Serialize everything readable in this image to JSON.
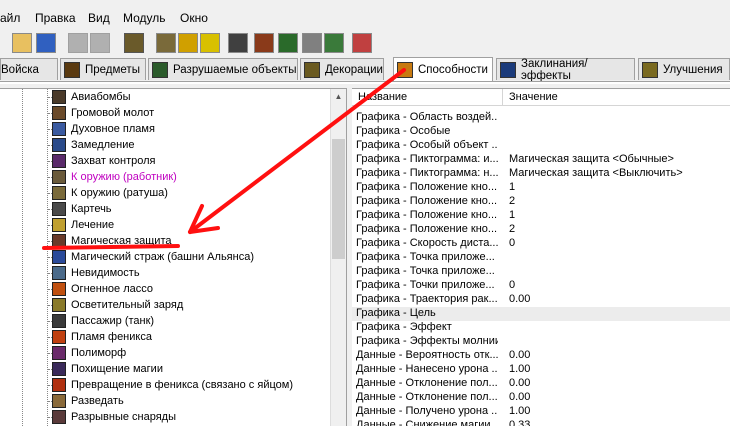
{
  "menu": [
    "айл",
    "Правка",
    "Вид",
    "Модуль",
    "Окно"
  ],
  "toolbar": {
    "icons": [
      "open-icon",
      "save-icon",
      "copy-icon",
      "paste-icon",
      "object-editor-icon",
      "terrain-icon",
      "gold-icon",
      "sound-icon",
      "unit-icon",
      "cinematic-icon",
      "camera-icon",
      "trigger-icon",
      "ai-icon",
      "import-icon",
      "test-map-icon"
    ]
  },
  "tabs": [
    "Войска",
    "Предметы",
    "Разрушаемые объекты",
    "Декорации",
    "Способности",
    "Заклинания/эффекты",
    "Улучшения"
  ],
  "tree": {
    "items": [
      {
        "label": "Авиабомбы",
        "color": "#000000"
      },
      {
        "label": "Громовой молот",
        "color": "#000000"
      },
      {
        "label": "Духовное пламя",
        "color": "#000000"
      },
      {
        "label": "Замедление",
        "color": "#000000"
      },
      {
        "label": "Захват контроля",
        "color": "#000000"
      },
      {
        "label": "К оружию (работник)",
        "color": "#c000c0"
      },
      {
        "label": "К оружию (ратуша)",
        "color": "#000000"
      },
      {
        "label": "Картечь",
        "color": "#000000"
      },
      {
        "label": "Лечение",
        "color": "#000000"
      },
      {
        "label": "Магическая защита",
        "color": "#000000"
      },
      {
        "label": "Магический страж (башни Альянса)",
        "color": "#000000"
      },
      {
        "label": "Невидимость",
        "color": "#000000"
      },
      {
        "label": "Огненное лассо",
        "color": "#000000"
      },
      {
        "label": "Осветительный заряд",
        "color": "#000000"
      },
      {
        "label": "Пассажир (танк)",
        "color": "#000000"
      },
      {
        "label": "Пламя феникса",
        "color": "#000000"
      },
      {
        "label": "Полиморф",
        "color": "#000000"
      },
      {
        "label": "Похищение магии",
        "color": "#000000"
      },
      {
        "label": "Превращение в феникса (связано с яйцом)",
        "color": "#000000"
      },
      {
        "label": "Разведать",
        "color": "#000000"
      },
      {
        "label": "Разрывные снаряды",
        "color": "#000000"
      }
    ]
  },
  "props": {
    "header_name": "Название",
    "header_value": "Значение",
    "rows": [
      {
        "name": "Графика - Область воздей...",
        "value": ""
      },
      {
        "name": "Графика - Особые",
        "value": ""
      },
      {
        "name": "Графика - Особый объект ...",
        "value": ""
      },
      {
        "name": "Графика - Пиктограмма: и...",
        "value": "Магическая защита <Обычные>"
      },
      {
        "name": "Графика - Пиктограмма: н...",
        "value": "Магическая защита <Выключить>"
      },
      {
        "name": "Графика - Положение кно...",
        "value": "1"
      },
      {
        "name": "Графика - Положение кно...",
        "value": "2"
      },
      {
        "name": "Графика - Положение кно...",
        "value": "1"
      },
      {
        "name": "Графика - Положение кно...",
        "value": "2"
      },
      {
        "name": "Графика - Скорость диста...",
        "value": "0"
      },
      {
        "name": "Графика - Точка приложе...",
        "value": ""
      },
      {
        "name": "Графика - Точка приложе...",
        "value": ""
      },
      {
        "name": "Графика - Точки приложе...",
        "value": "0"
      },
      {
        "name": "Графика - Траектория рак...",
        "value": "0.00"
      },
      {
        "name": "Графика - Цель",
        "value": ""
      },
      {
        "name": "Графика - Эффект",
        "value": ""
      },
      {
        "name": "Графика - Эффекты молнии",
        "value": ""
      },
      {
        "name": "Данные - Вероятность отк...",
        "value": "0.00"
      },
      {
        "name": "Данные - Нанесено урона ...",
        "value": "1.00"
      },
      {
        "name": "Данные - Отклонение пол...",
        "value": "0.00"
      },
      {
        "name": "Данные - Отклонение пол...",
        "value": "0.00"
      },
      {
        "name": "Данные - Получено урона ...",
        "value": "1.00"
      },
      {
        "name": "Данные - Снижение магии ...",
        "value": "0.33"
      }
    ]
  },
  "colors": {
    "annotation": "#ff0000",
    "window_bg": "#f0f0f0",
    "selected_row": "#ececec"
  }
}
